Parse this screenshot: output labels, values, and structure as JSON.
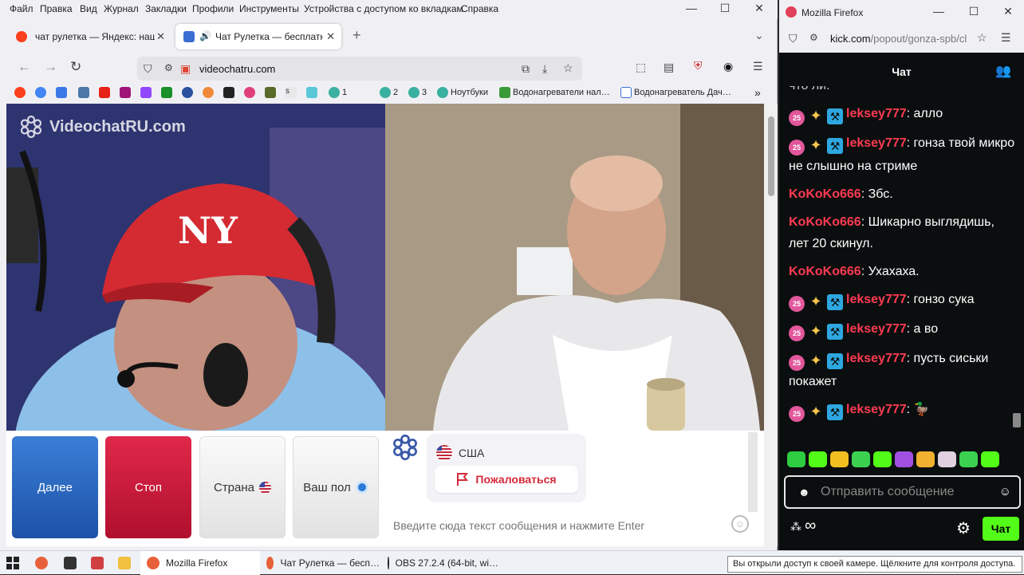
{
  "left_window": {
    "menu": [
      "Файл",
      "Правка",
      "Вид",
      "Журнал",
      "Закладки",
      "Профили",
      "Инструменты",
      "Устройства с доступом ко вкладкам",
      "Справка"
    ],
    "tabs": [
      {
        "label": "чат рулетка — Яндекс: нашло",
        "active": false
      },
      {
        "label": "Чат Рулетка — бесплатный",
        "active": true
      }
    ],
    "url": "videochatru.com",
    "bookmarks": [
      "1",
      "2",
      "3",
      "Ноутбуки",
      "Водонагреватели нал…",
      "Водонагреватель Дач…"
    ]
  },
  "page": {
    "logo_text": "VideochatRU.com",
    "buttons": {
      "next": "Далее",
      "stop": "Стоп",
      "country": "Страна",
      "gender": "Ваш пол"
    },
    "partner_country": "США",
    "report_label": "Пожаловаться",
    "message_placeholder": "Введите сюда текст сообщения и нажмите Enter"
  },
  "right_window": {
    "title": "Mozilla Firefox",
    "url_host": "kick.com",
    "url_path": "/popout/gonza-spb/cl",
    "chat_header": "Чат",
    "input_placeholder": "Отправить сообщение",
    "send_label": "Чат",
    "infinity": "∞",
    "messages": [
      {
        "user": "",
        "badges": false,
        "text": "что ли."
      },
      {
        "user": "leksey777",
        "badges": true,
        "text": "алло"
      },
      {
        "user": "leksey777",
        "badges": true,
        "text": "гонза твой микро не слышно на стриме"
      },
      {
        "user": "KoKoKo666",
        "badges": false,
        "text": "Збс."
      },
      {
        "user": "KoKoKo666",
        "badges": false,
        "text": "Шикарно выглядишь, лет 20 скинул."
      },
      {
        "user": "KoKoKo666",
        "badges": false,
        "text": "Ухахаха."
      },
      {
        "user": "leksey777",
        "badges": true,
        "text": "гонзо сука"
      },
      {
        "user": "leksey777",
        "badges": true,
        "text": "а во"
      },
      {
        "user": "leksey777",
        "badges": true,
        "text": "пусть сиськи покажет"
      },
      {
        "user": "leksey777",
        "badges": true,
        "text": "🦆"
      }
    ],
    "badge_25": "25"
  },
  "taskbar": {
    "items": [
      "Mozilla Firefox",
      "Чат Рулетка — бесп…",
      "OBS 27.2.4 (64-bit, wi…"
    ],
    "tooltip": "Вы открыли доступ к своей камере. Щёлкните для контроля доступа."
  },
  "colors": {
    "kick_green": "#53fc18",
    "stop_red": "#d01838",
    "next_blue": "#2a64c0",
    "kick_username": "#ff3b52"
  }
}
